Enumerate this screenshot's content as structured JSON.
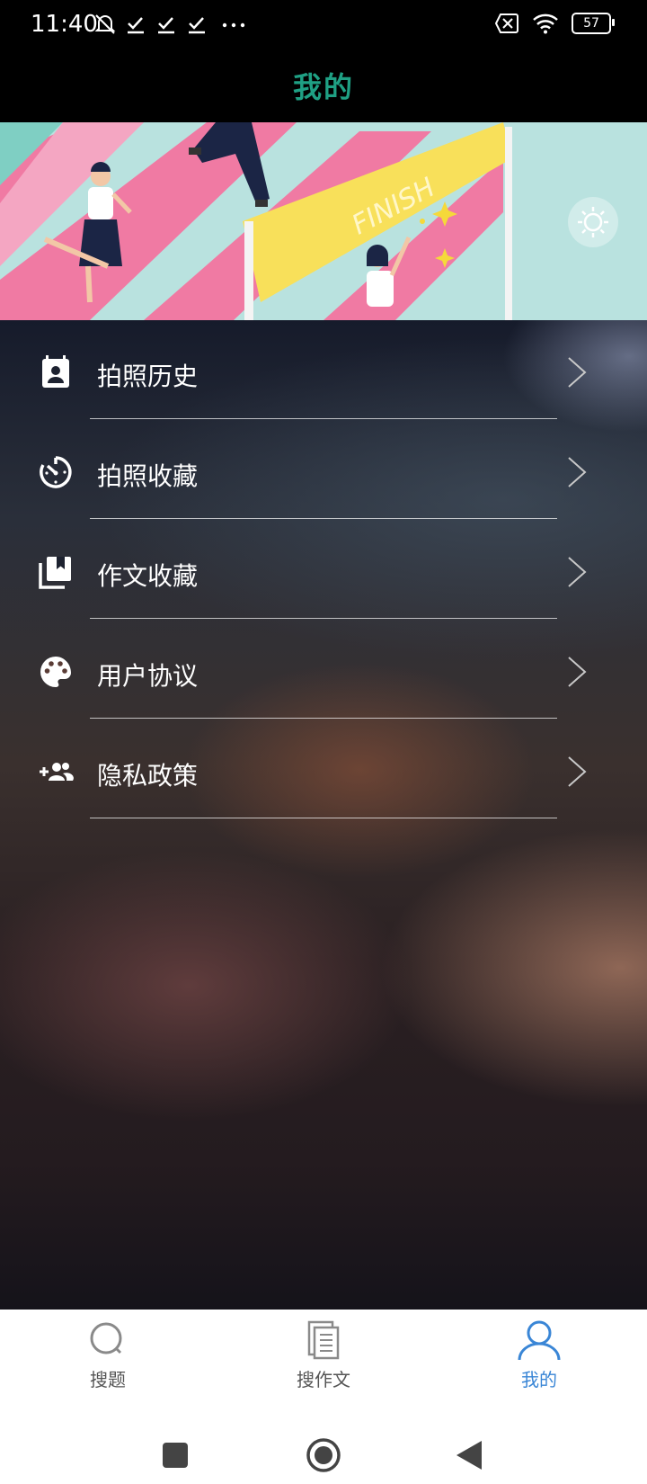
{
  "status_bar": {
    "time": "11:40",
    "battery": "57"
  },
  "header": {
    "title": "我的"
  },
  "banner": {
    "text": "FINISH"
  },
  "menu": {
    "items": [
      {
        "label": "拍照历史",
        "icon": "contact-calendar-icon"
      },
      {
        "label": "拍照收藏",
        "icon": "timer-icon"
      },
      {
        "label": "作文收藏",
        "icon": "collections-bookmark-icon"
      },
      {
        "label": "用户协议",
        "icon": "palette-icon"
      },
      {
        "label": "隐私政策",
        "icon": "group-add-icon"
      }
    ]
  },
  "bottom_nav": {
    "items": [
      {
        "label": "搜题",
        "icon": "search-icon",
        "active": false
      },
      {
        "label": "搜作文",
        "icon": "document-icon",
        "active": false
      },
      {
        "label": "我的",
        "icon": "user-icon",
        "active": true
      }
    ],
    "active_color": "#3a86d6",
    "inactive_color": "#555555"
  },
  "colors": {
    "title": "#1fa084"
  }
}
